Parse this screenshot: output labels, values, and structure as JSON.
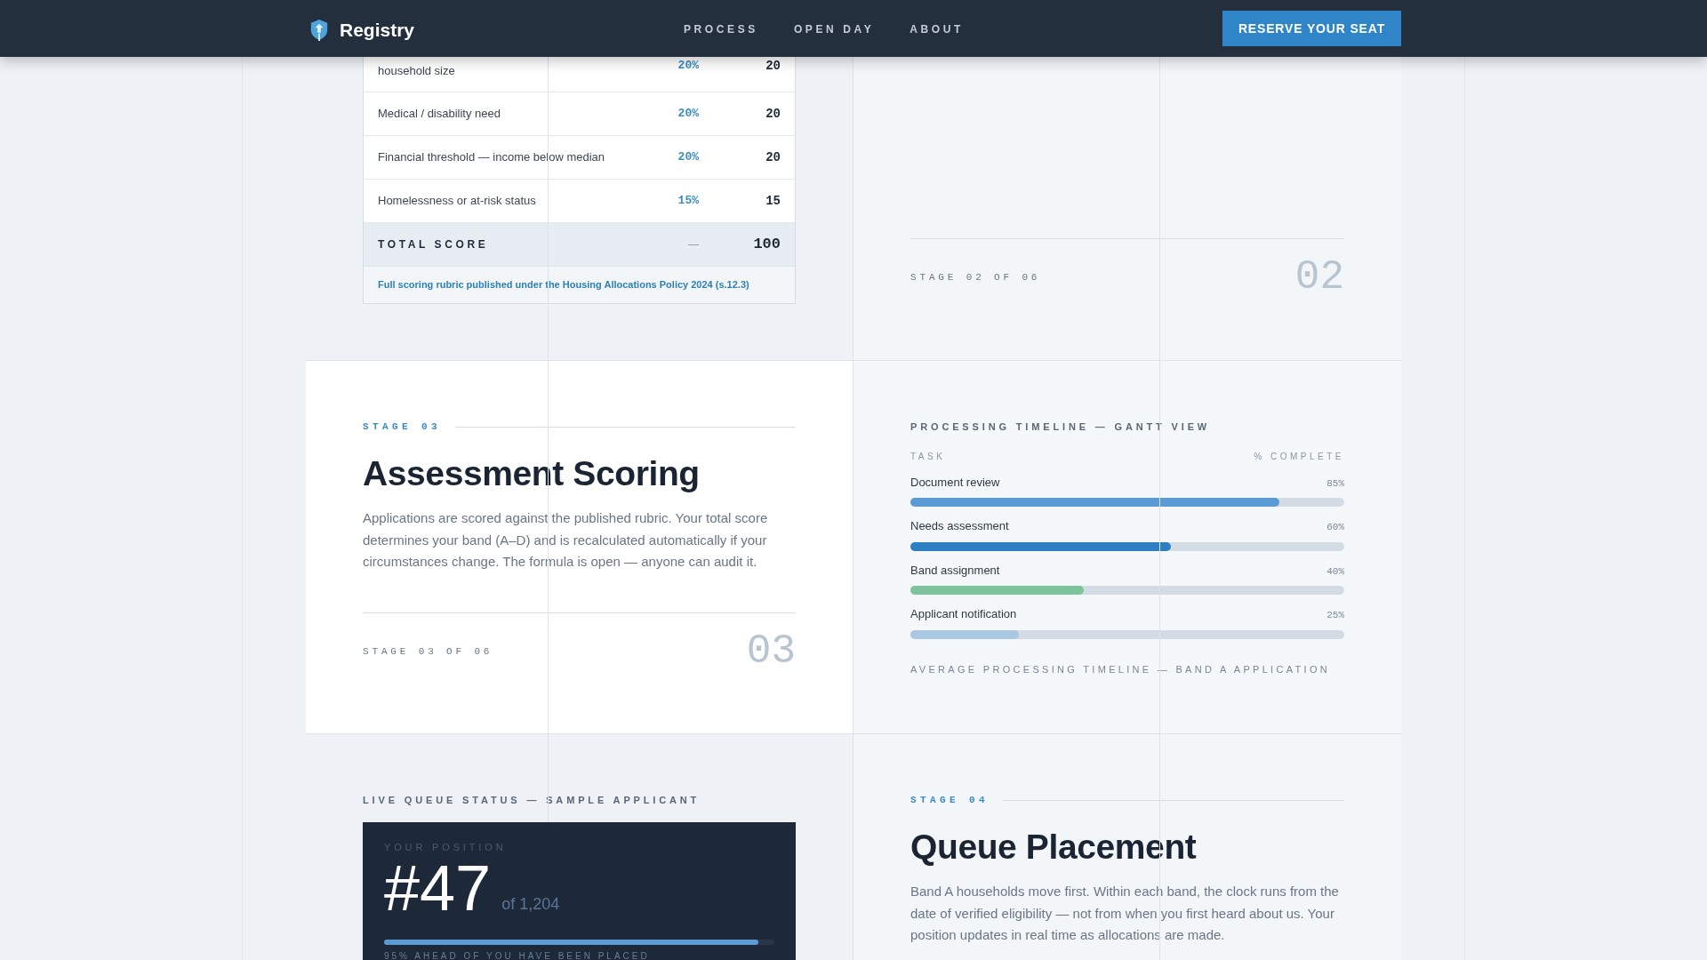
{
  "nav": {
    "brand": "Registry",
    "links": [
      "PROCESS",
      "OPEN DAY",
      "ABOUT"
    ],
    "cta": "RESERVE YOUR SEAT"
  },
  "rubric": {
    "rows": [
      {
        "criterion": "household size",
        "weight": "20%",
        "points": "20"
      },
      {
        "criterion": "Medical / disability need",
        "weight": "20%",
        "points": "20"
      },
      {
        "criterion": "Financial threshold — income below median",
        "weight": "20%",
        "points": "20"
      },
      {
        "criterion": "Homelessness or at-risk status",
        "weight": "15%",
        "points": "15"
      }
    ],
    "total": {
      "label": "TOTAL SCORE",
      "weight": "—",
      "points": "100"
    },
    "footnote": "Full scoring rubric published under the Housing Allocations Policy 2024 (s.12.3)"
  },
  "stage_02_footer": {
    "label": "STAGE 02 OF 06",
    "number": "02"
  },
  "stage_03": {
    "eyebrow": "STAGE 03",
    "title": "Assessment Scoring",
    "body": "Applications are scored against the published rubric. Your total score determines your band (A–D) and is recalculated automatically if your circumstances change. The formula is open — anyone can audit it.",
    "footer_label": "STAGE 03 OF 06",
    "footer_number": "03"
  },
  "timeline": {
    "title": "PROCESSING TIMELINE — GANTT VIEW",
    "columns": [
      "TASK",
      "% COMPLETE"
    ],
    "tasks": [
      {
        "name": "Document review",
        "percent": "85%",
        "level": 0.85,
        "color": "#5b9bd5"
      },
      {
        "name": "Needs assessment",
        "percent": "60%",
        "level": 0.6,
        "color": "#2b7fc2"
      },
      {
        "name": "Band assignment",
        "percent": "40%",
        "level": 0.4,
        "color": "#7dc49e"
      },
      {
        "name": "Applicant notification",
        "percent": "25%",
        "level": 0.25,
        "color": "#a9c8e4"
      }
    ],
    "caption": "AVERAGE PROCESSING TIMELINE — BAND A APPLICATION"
  },
  "queue_status": {
    "title": "LIVE QUEUE STATUS — SAMPLE APPLICANT",
    "position_label": "YOUR POSITION",
    "position": "#47",
    "total": "of 1,204",
    "level": 0.96,
    "caption": "95% AHEAD OF YOU HAVE BEEN PLACED"
  },
  "stage_04": {
    "eyebrow": "STAGE 04",
    "title": "Queue Placement",
    "body": "Band A households move first. Within each band, the clock runs from the date of verified eligibility — not from when you first heard about us. Your position updates in real time as allocations are made."
  }
}
